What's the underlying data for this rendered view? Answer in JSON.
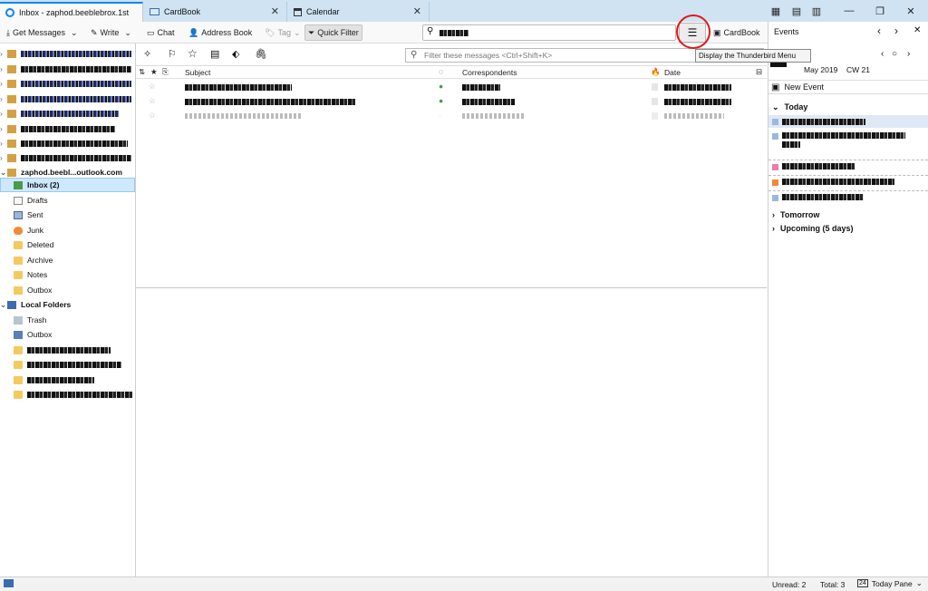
{
  "tabs": [
    {
      "label": "Inbox - zaphod.beeblebrox.1st"
    },
    {
      "label": "CardBook"
    },
    {
      "label": "Calendar"
    }
  ],
  "toolbar": {
    "get_messages": "Get Messages",
    "write": "Write",
    "chat": "Chat",
    "address_book": "Address Book",
    "tag": "Tag",
    "quick_filter": "Quick Filter",
    "search_value": "",
    "cardbook": "CardBook"
  },
  "tooltip": "Display the Thunderbird Menu",
  "folders": {
    "account_name": "zaphod.beebl...outlook.com",
    "inbox": "Inbox (2)",
    "drafts": "Drafts",
    "sent": "Sent",
    "junk": "Junk",
    "deleted": "Deleted",
    "archive": "Archive",
    "notes": "Notes",
    "outbox": "Outbox",
    "local_folders": "Local Folders",
    "local_trash": "Trash",
    "local_outbox": "Outbox"
  },
  "filter_placeholder": "Filter these messages <Ctrl+Shift+K>",
  "columns": {
    "subject": "Subject",
    "correspondents": "Correspondents",
    "date": "Date"
  },
  "today_pane": {
    "header": "Events",
    "day_suffix": "ri",
    "month_year": "May 2019",
    "week": "CW 21",
    "new_event": "New Event",
    "today": "Today",
    "tomorrow": "Tomorrow",
    "upcoming": "Upcoming (5 days)",
    "event_colors": [
      "#9bb8dc",
      "#9bb8dc",
      "#f07aa8",
      "#f08a3a",
      "#9bb8dc"
    ]
  },
  "status": {
    "unread": "Unread: 2",
    "total": "Total: 3",
    "today_pane_toggle": "Today Pane"
  },
  "colors": {
    "accent": "#0a84ff",
    "selection": "#cde8ff",
    "highlight_ring": "#e01818"
  }
}
